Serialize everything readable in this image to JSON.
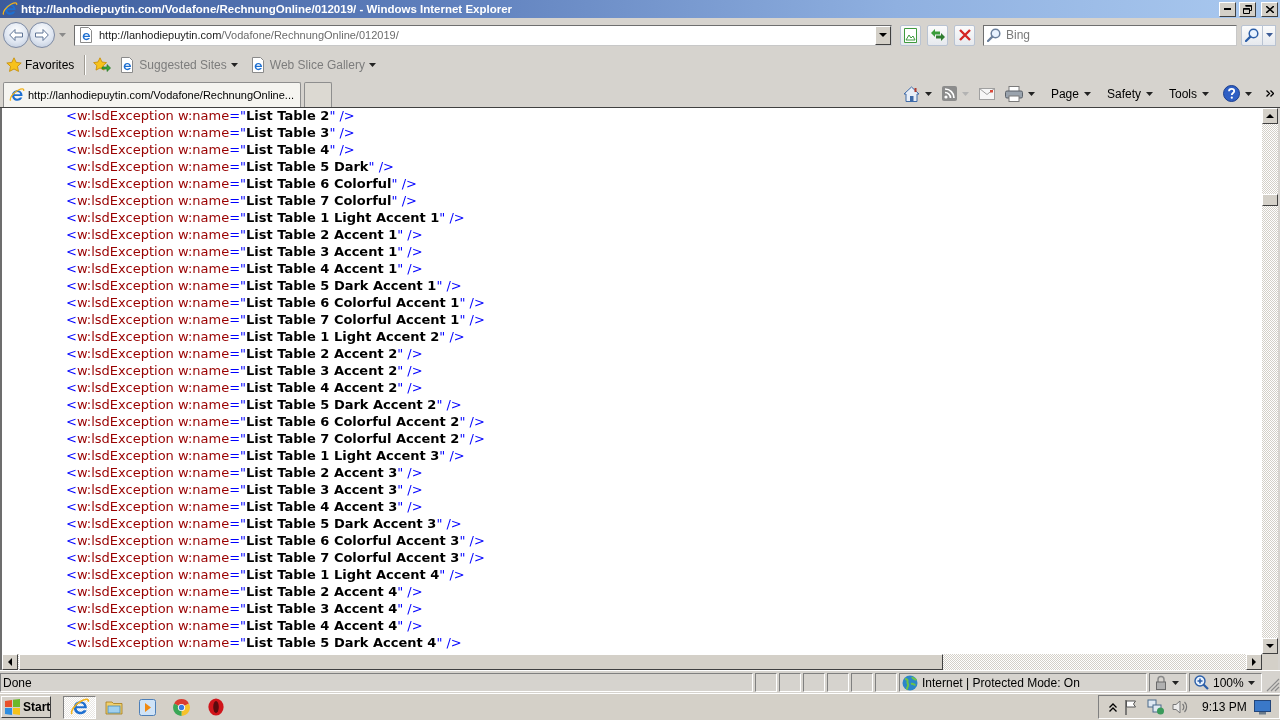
{
  "window": {
    "title": "http://lanhodiepuytin.com/Vodafone/RechnungOnline/012019/ - Windows Internet Explorer"
  },
  "address_bar": {
    "host": "http://lanhodiepuytin.com",
    "path": "/Vodafone/RechnungOnline/012019/"
  },
  "search": {
    "placeholder": "Bing"
  },
  "favorites_bar": {
    "label": "Favorites",
    "links": [
      {
        "label": "Suggested Sites"
      },
      {
        "label": "Web Slice Gallery"
      }
    ]
  },
  "tabs": [
    {
      "label": "http://lanhodiepuytin.com/Vodafone/RechnungOnline...",
      "selected": true
    }
  ],
  "command_bar": {
    "menus": [
      {
        "label": "Page"
      },
      {
        "label": "Safety"
      },
      {
        "label": "Tools"
      }
    ]
  },
  "document": {
    "lines": [
      {
        "open": "<",
        "element": "w:lsdException",
        "attribute": "w:name",
        "assign": "=\"",
        "value": "List Table 2",
        "close": "\" />"
      },
      {
        "open": "<",
        "element": "w:lsdException",
        "attribute": "w:name",
        "assign": "=\"",
        "value": "List Table 3",
        "close": "\" />"
      },
      {
        "open": "<",
        "element": "w:lsdException",
        "attribute": "w:name",
        "assign": "=\"",
        "value": "List Table 4",
        "close": "\" />"
      },
      {
        "open": "<",
        "element": "w:lsdException",
        "attribute": "w:name",
        "assign": "=\"",
        "value": "List Table 5 Dark",
        "close": "\" />"
      },
      {
        "open": "<",
        "element": "w:lsdException",
        "attribute": "w:name",
        "assign": "=\"",
        "value": "List Table 6 Colorful",
        "close": "\" />"
      },
      {
        "open": "<",
        "element": "w:lsdException",
        "attribute": "w:name",
        "assign": "=\"",
        "value": "List Table 7 Colorful",
        "close": "\" />"
      },
      {
        "open": "<",
        "element": "w:lsdException",
        "attribute": "w:name",
        "assign": "=\"",
        "value": "List Table 1 Light Accent 1",
        "close": "\" />"
      },
      {
        "open": "<",
        "element": "w:lsdException",
        "attribute": "w:name",
        "assign": "=\"",
        "value": "List Table 2 Accent 1",
        "close": "\" />"
      },
      {
        "open": "<",
        "element": "w:lsdException",
        "attribute": "w:name",
        "assign": "=\"",
        "value": "List Table 3 Accent 1",
        "close": "\" />"
      },
      {
        "open": "<",
        "element": "w:lsdException",
        "attribute": "w:name",
        "assign": "=\"",
        "value": "List Table 4 Accent 1",
        "close": "\" />"
      },
      {
        "open": "<",
        "element": "w:lsdException",
        "attribute": "w:name",
        "assign": "=\"",
        "value": "List Table 5 Dark Accent 1",
        "close": "\" />"
      },
      {
        "open": "<",
        "element": "w:lsdException",
        "attribute": "w:name",
        "assign": "=\"",
        "value": "List Table 6 Colorful Accent 1",
        "close": "\" />"
      },
      {
        "open": "<",
        "element": "w:lsdException",
        "attribute": "w:name",
        "assign": "=\"",
        "value": "List Table 7 Colorful Accent 1",
        "close": "\" />"
      },
      {
        "open": "<",
        "element": "w:lsdException",
        "attribute": "w:name",
        "assign": "=\"",
        "value": "List Table 1 Light Accent 2",
        "close": "\" />"
      },
      {
        "open": "<",
        "element": "w:lsdException",
        "attribute": "w:name",
        "assign": "=\"",
        "value": "List Table 2 Accent 2",
        "close": "\" />"
      },
      {
        "open": "<",
        "element": "w:lsdException",
        "attribute": "w:name",
        "assign": "=\"",
        "value": "List Table 3 Accent 2",
        "close": "\" />"
      },
      {
        "open": "<",
        "element": "w:lsdException",
        "attribute": "w:name",
        "assign": "=\"",
        "value": "List Table 4 Accent 2",
        "close": "\" />"
      },
      {
        "open": "<",
        "element": "w:lsdException",
        "attribute": "w:name",
        "assign": "=\"",
        "value": "List Table 5 Dark Accent 2",
        "close": "\" />"
      },
      {
        "open": "<",
        "element": "w:lsdException",
        "attribute": "w:name",
        "assign": "=\"",
        "value": "List Table 6 Colorful Accent 2",
        "close": "\" />"
      },
      {
        "open": "<",
        "element": "w:lsdException",
        "attribute": "w:name",
        "assign": "=\"",
        "value": "List Table 7 Colorful Accent 2",
        "close": "\" />"
      },
      {
        "open": "<",
        "element": "w:lsdException",
        "attribute": "w:name",
        "assign": "=\"",
        "value": "List Table 1 Light Accent 3",
        "close": "\" />"
      },
      {
        "open": "<",
        "element": "w:lsdException",
        "attribute": "w:name",
        "assign": "=\"",
        "value": "List Table 2 Accent 3",
        "close": "\" />"
      },
      {
        "open": "<",
        "element": "w:lsdException",
        "attribute": "w:name",
        "assign": "=\"",
        "value": "List Table 3 Accent 3",
        "close": "\" />"
      },
      {
        "open": "<",
        "element": "w:lsdException",
        "attribute": "w:name",
        "assign": "=\"",
        "value": "List Table 4 Accent 3",
        "close": "\" />"
      },
      {
        "open": "<",
        "element": "w:lsdException",
        "attribute": "w:name",
        "assign": "=\"",
        "value": "List Table 5 Dark Accent 3",
        "close": "\" />"
      },
      {
        "open": "<",
        "element": "w:lsdException",
        "attribute": "w:name",
        "assign": "=\"",
        "value": "List Table 6 Colorful Accent 3",
        "close": "\" />"
      },
      {
        "open": "<",
        "element": "w:lsdException",
        "attribute": "w:name",
        "assign": "=\"",
        "value": "List Table 7 Colorful Accent 3",
        "close": "\" />"
      },
      {
        "open": "<",
        "element": "w:lsdException",
        "attribute": "w:name",
        "assign": "=\"",
        "value": "List Table 1 Light Accent 4",
        "close": "\" />"
      },
      {
        "open": "<",
        "element": "w:lsdException",
        "attribute": "w:name",
        "assign": "=\"",
        "value": "List Table 2 Accent 4",
        "close": "\" />"
      },
      {
        "open": "<",
        "element": "w:lsdException",
        "attribute": "w:name",
        "assign": "=\"",
        "value": "List Table 3 Accent 4",
        "close": "\" />"
      },
      {
        "open": "<",
        "element": "w:lsdException",
        "attribute": "w:name",
        "assign": "=\"",
        "value": "List Table 4 Accent 4",
        "close": "\" />"
      },
      {
        "open": "<",
        "element": "w:lsdException",
        "attribute": "w:name",
        "assign": "=\"",
        "value": "List Table 5 Dark Accent 4",
        "close": "\" />"
      }
    ]
  },
  "status_bar": {
    "text": "Done",
    "zone": "Internet | Protected Mode: On",
    "zoom": "100%"
  },
  "taskbar": {
    "start": "Start",
    "apps": [
      {
        "kind": "internet",
        "selected": true
      },
      {
        "kind": "files",
        "selected": false
      },
      {
        "kind": "media",
        "selected": false
      },
      {
        "kind": "wheel",
        "selected": false
      },
      {
        "kind": "ring",
        "selected": false
      }
    ],
    "clock": "9:13 PM"
  }
}
